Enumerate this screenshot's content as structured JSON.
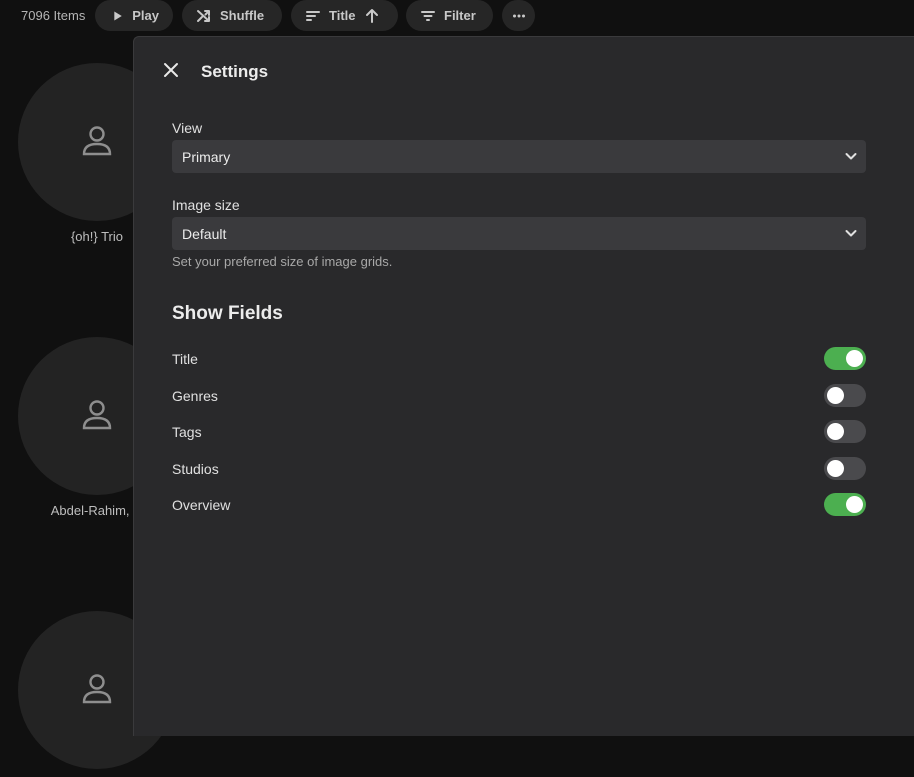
{
  "toolbar": {
    "item_count": "7096 Items",
    "play_label": "Play",
    "shuffle_label": "Shuffle",
    "sort_label": "Title",
    "filter_label": "Filter"
  },
  "grid": {
    "cards": [
      {
        "name": "{oh!} Trio"
      },
      {
        "name": "Abdel-Rahim, G"
      },
      {
        "name": ""
      }
    ]
  },
  "settings": {
    "title": "Settings",
    "view": {
      "label": "View",
      "value": "Primary"
    },
    "image_size": {
      "label": "Image size",
      "value": "Default",
      "help": "Set your preferred size of image grids."
    },
    "show_fields": {
      "heading": "Show Fields",
      "fields": [
        {
          "label": "Title",
          "on": true
        },
        {
          "label": "Genres",
          "on": false
        },
        {
          "label": "Tags",
          "on": false
        },
        {
          "label": "Studios",
          "on": false
        },
        {
          "label": "Overview",
          "on": true
        }
      ]
    }
  },
  "colors": {
    "toggle_on": "#4caf50",
    "panel_bg": "#29292b"
  }
}
